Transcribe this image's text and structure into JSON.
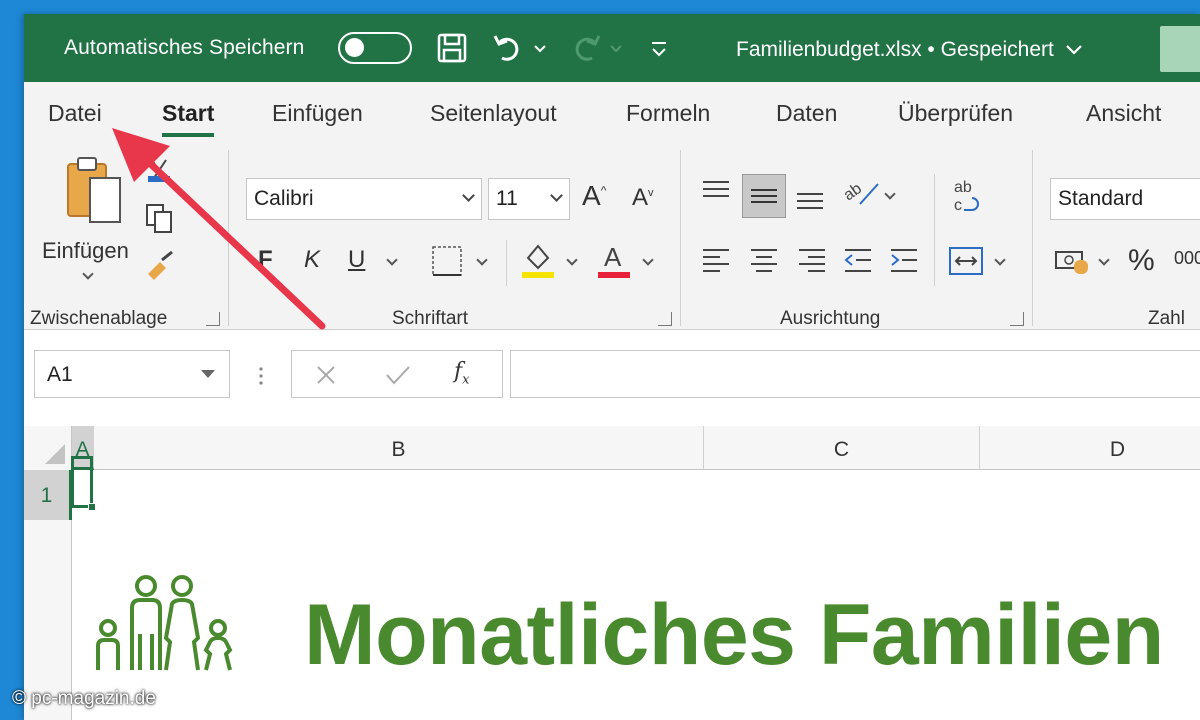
{
  "titlebar": {
    "autosave_label": "Automatisches Speichern",
    "file_title": "Familienbudget.xlsx • Gespeichert"
  },
  "tabs": [
    {
      "label": "Datei"
    },
    {
      "label": "Start"
    },
    {
      "label": "Einfügen"
    },
    {
      "label": "Seitenlayout"
    },
    {
      "label": "Formeln"
    },
    {
      "label": "Daten"
    },
    {
      "label": "Überprüfen"
    },
    {
      "label": "Ansicht"
    }
  ],
  "ribbon": {
    "clipboard": {
      "paste_label": "Einfügen",
      "group_label": "Zwischenablage"
    },
    "font": {
      "font_name": "Calibri",
      "font_size": "11",
      "bold": "F",
      "italic": "K",
      "underline": "U",
      "group_label": "Schriftart"
    },
    "alignment": {
      "group_label": "Ausrichtung"
    },
    "number": {
      "format": "Standard",
      "group_label": "Zahl"
    }
  },
  "formula_bar": {
    "name_box": "A1",
    "formula_value": ""
  },
  "grid": {
    "columns": [
      "A",
      "B",
      "C",
      "D"
    ],
    "rows": [
      "1"
    ]
  },
  "sheet": {
    "title": "Monatliches Familien"
  },
  "watermark": "© pc-magazin.de",
  "colors": {
    "excel_green": "#217346",
    "title_green": "#4a8a2e",
    "annotation_arrow": "#e8364a"
  }
}
